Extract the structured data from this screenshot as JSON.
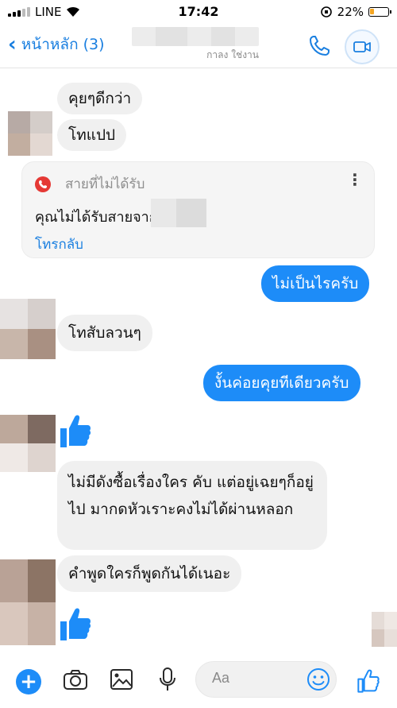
{
  "status_bar": {
    "carrier": "LINE",
    "time": "17:42",
    "battery": "22%",
    "battery_level": 0.22
  },
  "header": {
    "back_label": "หน้าหลัก (3)",
    "subtitle": "กาลง ใช่งาน"
  },
  "messages": {
    "m1": "คุยๆดีกว่า",
    "m2": "โทแปป",
    "missed_call": {
      "label": "สายที่ไม่ได้รับ",
      "text": "คุณไม่ได้รับสายจาก",
      "action": "โทรกลับ"
    },
    "m3": "ไม่เป็นไรครับ",
    "m4": "โทสับลวนๆ",
    "m5": "งั้นค่อยคุยทีเดียวครับ",
    "m6": "ไม่มีดังซื้อเรื่องใคร คับ แต่อยู่เฉยๆก็อยู่ไป มากดหัวเราะคงไม่ได้ผ่านหลอก",
    "m7": "คำพูดใครก็พูดกันได้เนอะ"
  },
  "composer": {
    "placeholder": "Aa"
  },
  "colors": {
    "accent": "#1d8cf8",
    "incoming_bubble": "#f0f0f0",
    "missed": "#e53935"
  },
  "icons": [
    "back-chevron-icon",
    "phone-icon",
    "video-camera-icon",
    "missed-call-icon",
    "more-dots-icon",
    "thumbs-up-icon",
    "plus-icon",
    "camera-icon",
    "image-icon",
    "microphone-icon",
    "emoji-icon"
  ]
}
